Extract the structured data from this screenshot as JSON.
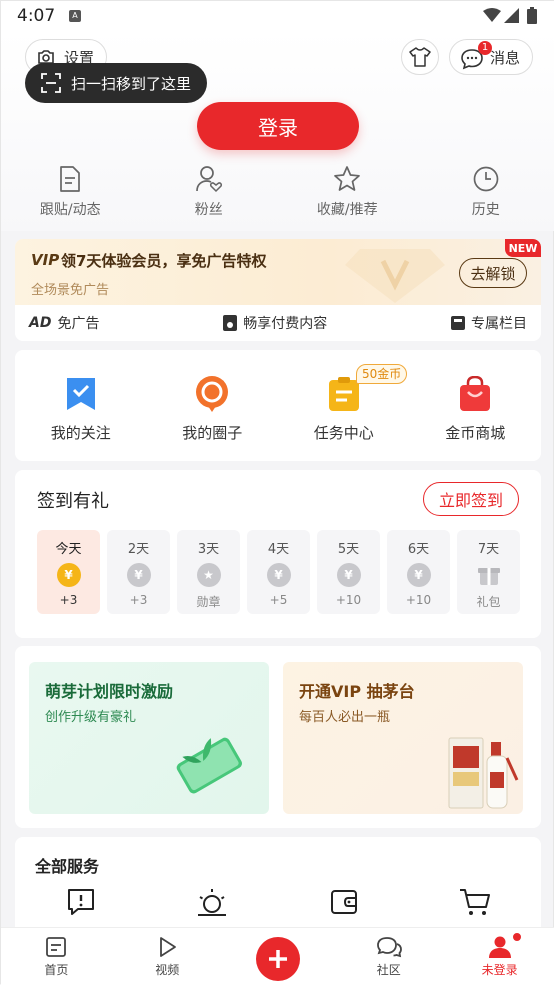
{
  "status_bar": {
    "time": "4:07",
    "notif_letter": "A"
  },
  "header": {
    "settings_label": "设置",
    "tooltip_text": "扫一扫移到了这里",
    "messages_label": "消息",
    "messages_badge": "1",
    "login_label": "登录"
  },
  "quick_links": [
    {
      "label": "跟贴/动态",
      "icon": "document-icon"
    },
    {
      "label": "粉丝",
      "icon": "user-heart-icon"
    },
    {
      "label": "收藏/推荐",
      "icon": "star-icon"
    },
    {
      "label": "历史",
      "icon": "clock-icon"
    }
  ],
  "vip": {
    "logo": "VIP",
    "title": "领7天体验会员，享免广告特权",
    "subtitle": "全场景免广告",
    "unlock_label": "去解锁",
    "new_badge": "NEW",
    "features": [
      {
        "label": "免广告",
        "icon": "ad-icon",
        "icon_text": "AD"
      },
      {
        "label": "畅享付费内容",
        "icon": "paid-content-icon"
      },
      {
        "label": "专属栏目",
        "icon": "column-icon"
      }
    ]
  },
  "shortcuts": [
    {
      "label": "我的关注",
      "icon": "bookmark-icon",
      "color": "#3b8ff0"
    },
    {
      "label": "我的圈子",
      "icon": "circle-chat-icon",
      "color": "#f2722b"
    },
    {
      "label": "任务中心",
      "icon": "task-icon",
      "color": "#f5b518",
      "tag": "50金币"
    },
    {
      "label": "金币商城",
      "icon": "shopping-bag-icon",
      "color": "#ef3a3a"
    }
  ],
  "signin": {
    "title": "签到有礼",
    "button_label": "立即签到",
    "days": [
      {
        "day": "今天",
        "reward": "+3",
        "icon": "¥"
      },
      {
        "day": "2天",
        "reward": "+3",
        "icon": "¥"
      },
      {
        "day": "3天",
        "reward": "勋章",
        "icon": "★"
      },
      {
        "day": "4天",
        "reward": "+5",
        "icon": "¥"
      },
      {
        "day": "5天",
        "reward": "+10",
        "icon": "¥"
      },
      {
        "day": "6天",
        "reward": "+10",
        "icon": "¥"
      },
      {
        "day": "7天",
        "reward": "礼包",
        "icon": "gift"
      }
    ]
  },
  "promos": [
    {
      "title": "萌芽计划限时激励",
      "subtitle": "创作升级有豪礼"
    },
    {
      "title": "开通VIP 抽茅台",
      "subtitle": "每百人必出一瓶"
    }
  ],
  "services": {
    "title": "全部服务",
    "icons": [
      "alert-icon",
      "sun-icon",
      "wallet-icon",
      "cart-icon"
    ]
  },
  "tabbar": [
    {
      "label": "首页",
      "icon": "home-icon"
    },
    {
      "label": "视频",
      "icon": "play-icon"
    },
    {
      "label": "",
      "icon": "plus-icon"
    },
    {
      "label": "社区",
      "icon": "community-icon"
    },
    {
      "label": "未登录",
      "icon": "user-icon"
    }
  ],
  "colors": {
    "accent": "#e8282b",
    "vip_brown": "#4a2f12",
    "gold": "#f5b518"
  }
}
